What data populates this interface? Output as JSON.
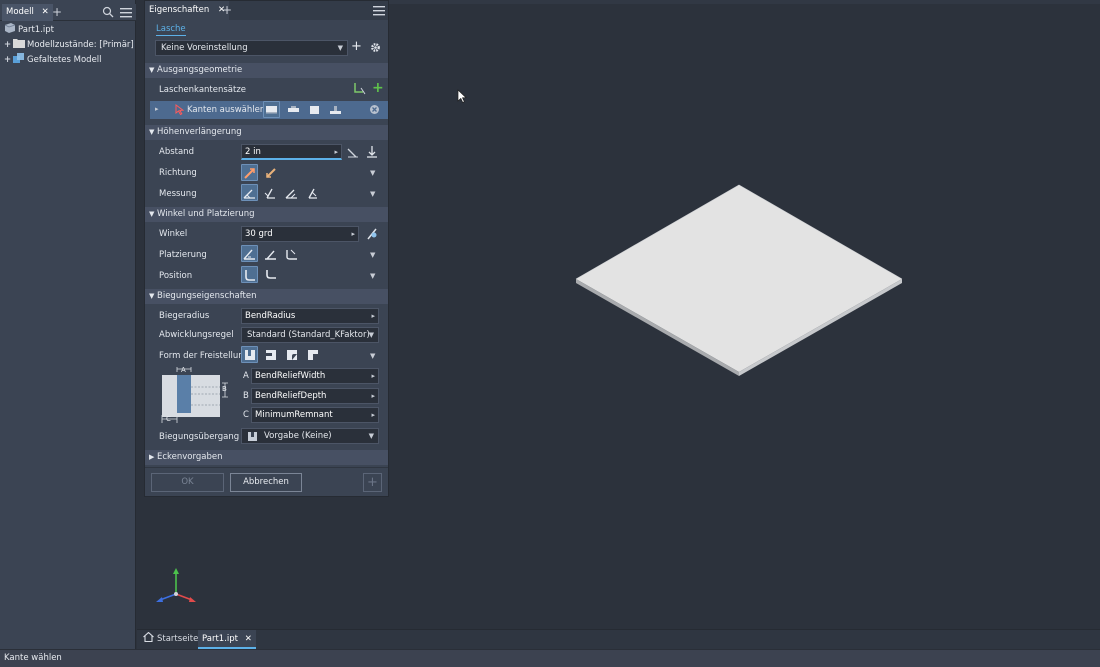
{
  "model_browser": {
    "tab_label": "Modell",
    "tree": [
      {
        "label": "Part1.ipt",
        "expander": ""
      },
      {
        "label": "Modellzustände: [Primär]",
        "expander": "+"
      },
      {
        "label": "Gefaltetes Modell",
        "expander": "+"
      }
    ]
  },
  "properties": {
    "tab_label": "Eigenschaften",
    "feature_tab": "Lasche",
    "preset": "Keine Voreinstellung",
    "sections": {
      "input_geometry": {
        "title": "Ausgangsgeometrie",
        "edge_sets_label": "Laschenkantensätze",
        "select_edges_label": "Kanten auswählen"
      },
      "height_extent": {
        "title": "Höhenverlängerung",
        "distance_label": "Abstand",
        "distance_value": "2 in",
        "direction_label": "Richtung",
        "measure_label": "Messung"
      },
      "angle_placement": {
        "title": "Winkel und Platzierung",
        "angle_label": "Winkel",
        "angle_value": "30 grd",
        "placement_label": "Platzierung",
        "position_label": "Position"
      },
      "bend_properties": {
        "title": "Biegungseigenschaften",
        "bend_radius_label": "Biegeradius",
        "bend_radius_value": "BendRadius",
        "unfold_rule_label": "Abwicklungsregel",
        "unfold_rule_value": "Standard (Standard_KFaktor)",
        "relief_shape_label": "Form der Freistellung",
        "param_a_letter": "A",
        "param_a_value": "BendReliefWidth",
        "param_b_letter": "B",
        "param_b_value": "BendReliefDepth",
        "param_c_letter": "C",
        "param_c_value": "MinimumRemnant",
        "diagram_a": "A",
        "diagram_b": "B",
        "diagram_c": "C",
        "transition_label": "Biegungsübergang",
        "transition_value": "Vorgabe (Keine)"
      },
      "corner": {
        "title": "Eckenvorgaben"
      }
    },
    "ok_label": "OK",
    "cancel_label": "Abbrechen"
  },
  "doc_tabs": [
    {
      "label": "Startseite"
    },
    {
      "label": "Part1.ipt"
    }
  ],
  "status_text": "Kante wählen",
  "colors": {
    "accent": "#5db1e8",
    "background": "#2c323c",
    "panel": "#3b4453",
    "sheet_top": "#e0e0e0"
  }
}
